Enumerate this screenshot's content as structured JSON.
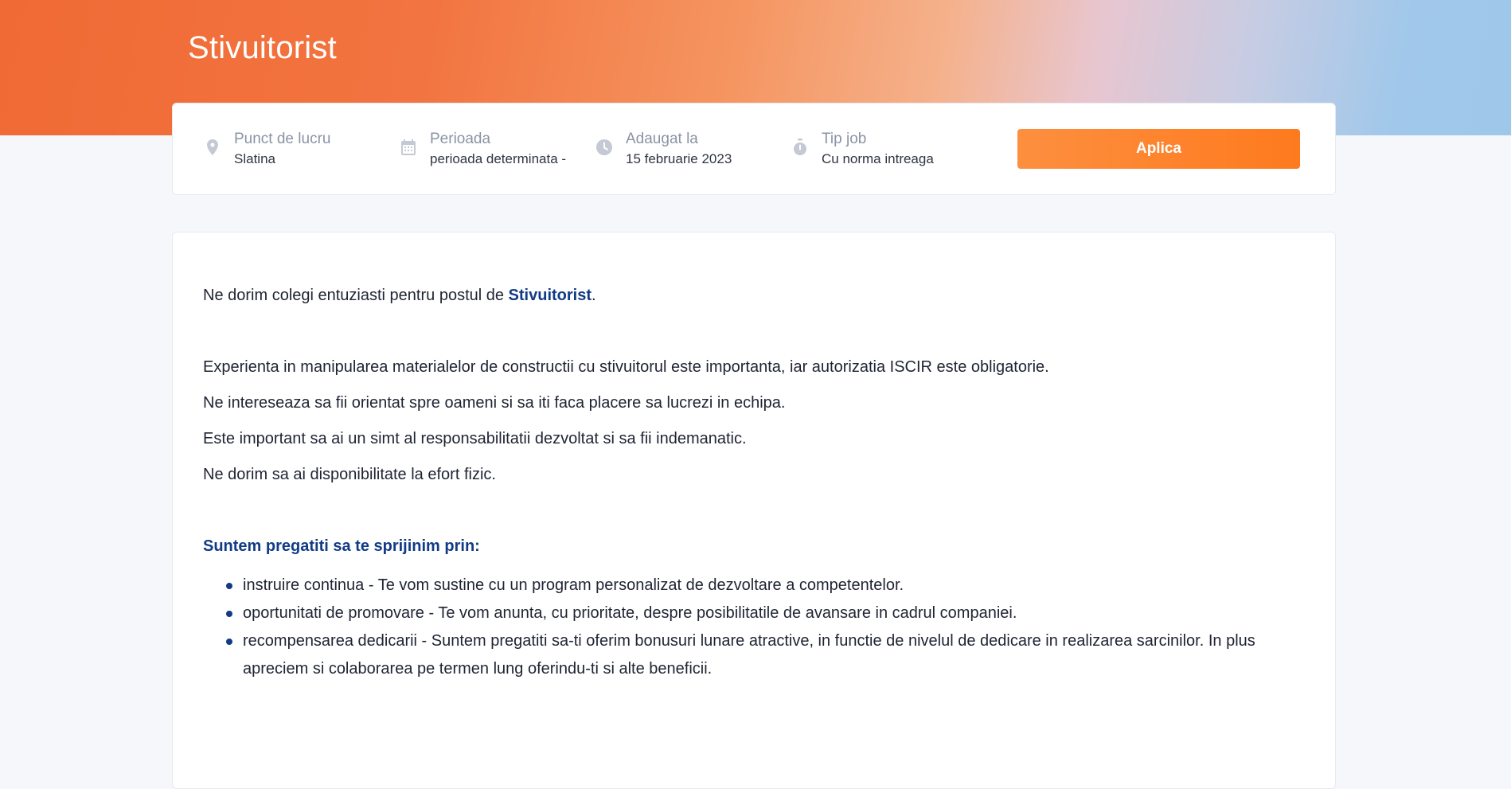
{
  "colors": {
    "accent_orange": "#fe7a1e",
    "brand_blue": "#123b86",
    "icon_gray": "#c4c9d4"
  },
  "header": {
    "title": "Stivuitorist"
  },
  "info": {
    "location": {
      "icon": "map-pin-icon",
      "label": "Punct de lucru",
      "value": "Slatina"
    },
    "period": {
      "icon": "calendar-icon",
      "label": "Perioada",
      "value": "perioada determinata -"
    },
    "added": {
      "icon": "clock-icon",
      "label": "Adaugat la",
      "value": "15 februarie 2023"
    },
    "job_type": {
      "icon": "stopwatch-icon",
      "label": "Tip job",
      "value": "Cu norma intreaga"
    },
    "apply_label": "Aplica"
  },
  "content": {
    "intro_prefix": "Ne dorim colegi entuziasti pentru postul de ",
    "intro_job": "Stivuitorist",
    "intro_suffix": ".",
    "requirements": [
      "Experienta in manipularea materialelor de constructii cu stivuitorul este importanta, iar autorizatia ISCIR este obligatorie.",
      "Ne intereseaza sa fii orientat spre oameni si sa iti faca placere sa lucrezi in echipa.",
      "Este important sa ai un simt al responsabilitatii dezvoltat si sa fii indemanatic.",
      "Ne dorim sa ai disponibilitate la efort fizic."
    ],
    "benefits_heading": "Suntem pregatiti sa te sprijinim prin:",
    "benefits": [
      "instruire continua - Te vom sustine cu un program personalizat de dezvoltare a competentelor.",
      "oportunitati de promovare - Te vom anunta, cu prioritate, despre posibilitatile de avansare in cadrul companiei.",
      "recompensarea dedicarii - Suntem pregatiti sa-ti oferim bonusuri lunare atractive, in functie de nivelul de dedicare in realizarea sarcinilor. In plus apreciem si colaborarea pe termen lung oferindu-ti si alte beneficii."
    ]
  }
}
